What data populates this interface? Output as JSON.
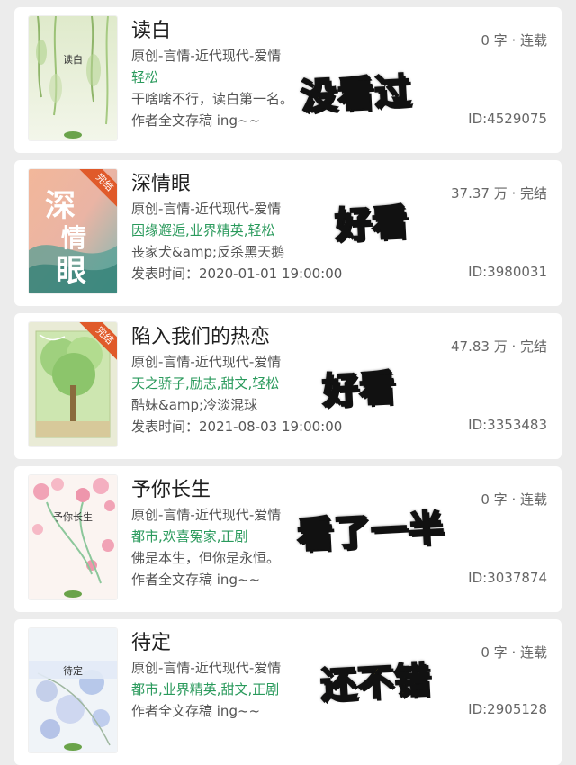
{
  "books": [
    {
      "title": "读白",
      "genre": "原创-言情-近代现代-爱情",
      "tags": "轻松",
      "line4": "干啥啥不行，读白第一名。",
      "line5": "作者全文存稿 ing~~",
      "stat": "0 字 · 连载",
      "id": "ID:4529075",
      "sticker": "没看过",
      "cover_text": "读白",
      "cover_badge": ""
    },
    {
      "title": "深情眼",
      "genre": "原创-言情-近代现代-爱情",
      "tags": "因缘邂逅,业界精英,轻松",
      "line4": "丧家犬&amp;反杀黑天鹅",
      "line5": "发表时间：2020-01-01 19:00:00",
      "stat": "37.37 万 · 完结",
      "id": "ID:3980031",
      "sticker": "好看",
      "cover_text": "深情眼",
      "cover_badge": "完结"
    },
    {
      "title": "陷入我们的热恋",
      "genre": "原创-言情-近代现代-爱情",
      "tags": "天之骄子,励志,甜文,轻松",
      "line4": "酷妹&amp;冷淡混球",
      "line5": "发表时间：2021-08-03 19:00:00",
      "stat": "47.83 万 · 完结",
      "id": "ID:3353483",
      "sticker": "好看",
      "cover_text": "",
      "cover_badge": "完结"
    },
    {
      "title": "予你长生",
      "genre": "原创-言情-近代现代-爱情",
      "tags": "都市,欢喜冤家,正剧",
      "line4": "佛是本生，但你是永恒。",
      "line5": "作者全文存稿 ing~~",
      "stat": "0 字 · 连载",
      "id": "ID:3037874",
      "sticker": "看了一半",
      "cover_text": "予你长生",
      "cover_badge": ""
    },
    {
      "title": "待定",
      "genre": "原创-言情-近代现代-爱情",
      "tags": "都市,业界精英,甜文,正剧",
      "line4": "作者全文存稿 ing~~",
      "line5": "",
      "stat": "0 字 · 连载",
      "id": "ID:2905128",
      "sticker": "还不错",
      "cover_text": "待定",
      "cover_badge": ""
    }
  ],
  "colors": {
    "tag_green": "#2a9a5c",
    "sticker_yellow": "#f7d417",
    "ribbon_orange": "#e05a2a"
  }
}
